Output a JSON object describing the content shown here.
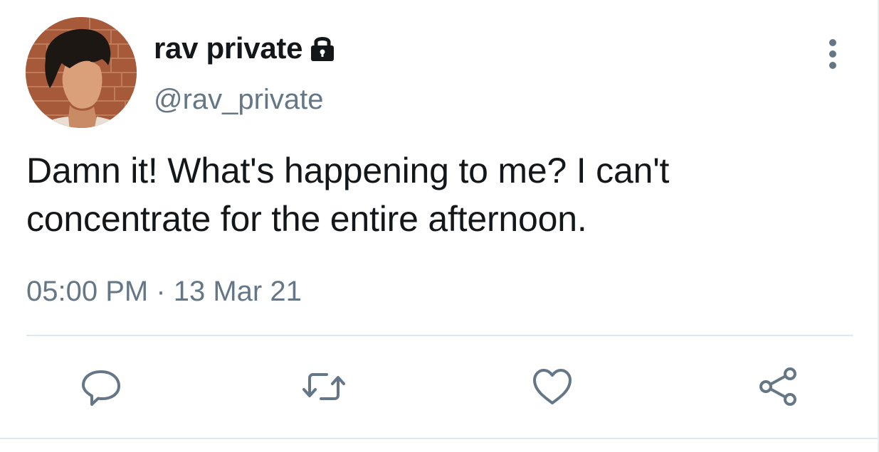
{
  "tweet": {
    "display_name": "rav private",
    "handle": "@rav_private",
    "text_line1": "Damn it! What's happening to me? I can't",
    "text_line2": "concentrate for the entire afternoon.",
    "timestamp": "05:00 PM · 13 Mar 21"
  },
  "icons": {
    "lock": "lock-icon",
    "more": "more-vertical-icon",
    "reply": "reply-icon",
    "retweet": "retweet-icon",
    "like": "heart-icon",
    "share": "share-icon"
  },
  "colors": {
    "text_primary": "#14171a",
    "text_secondary": "#657786",
    "icon_gray": "#657786",
    "divider": "#e1e8ed"
  }
}
